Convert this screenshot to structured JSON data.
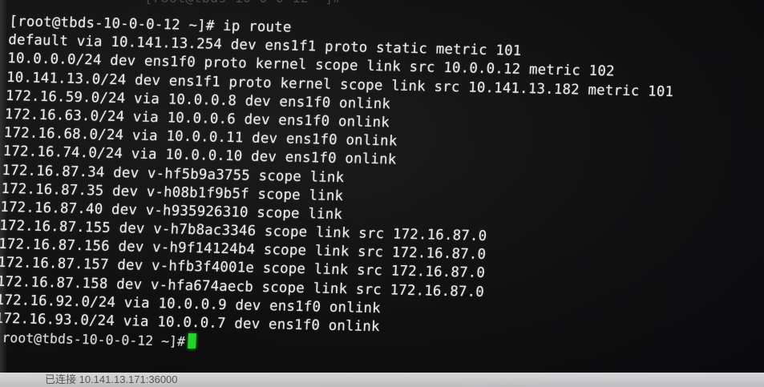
{
  "terminal": {
    "top_fragment": "[root@tbds-10-0-0-12 ~]#",
    "first_prompt": "[root@tbds-10-0-0-12 ~]# ip route",
    "lines": [
      "default via 10.141.13.254 dev ens1f1 proto static metric 101",
      "10.0.0.0/24 dev ens1f0 proto kernel scope link src 10.0.0.12 metric 102",
      "10.141.13.0/24 dev ens1f1 proto kernel scope link src 10.141.13.182 metric 101",
      "172.16.59.0/24 via 10.0.0.8 dev ens1f0 onlink",
      "172.16.63.0/24 via 10.0.0.6 dev ens1f0 onlink",
      "172.16.68.0/24 via 10.0.0.11 dev ens1f0 onlink",
      "172.16.74.0/24 via 10.0.0.10 dev ens1f0 onlink",
      "172.16.87.34 dev v-hf5b9a3755 scope link",
      "172.16.87.35 dev v-h08b1f9b5f scope link",
      "172.16.87.40 dev v-h935926310 scope link",
      "172.16.87.155 dev v-h7b8ac3346 scope link src 172.16.87.0",
      "172.16.87.156 dev v-h9f14124b4 scope link src 172.16.87.0",
      "172.16.87.157 dev v-hfb3f4001e scope link src 172.16.87.0",
      "172.16.87.158 dev v-hfa674aecb scope link src 172.16.87.0",
      "172.16.92.0/24 via 10.0.0.9 dev ens1f0 onlink",
      "172.16.93.0/24 via 10.0.0.7 dev ens1f0 onlink"
    ],
    "final_prompt": "[root@tbds-10-0-0-12 ~]#",
    "cursor_color": "#22d329"
  },
  "status_bar": {
    "text": "已连接 10.141.13.171:36000"
  }
}
